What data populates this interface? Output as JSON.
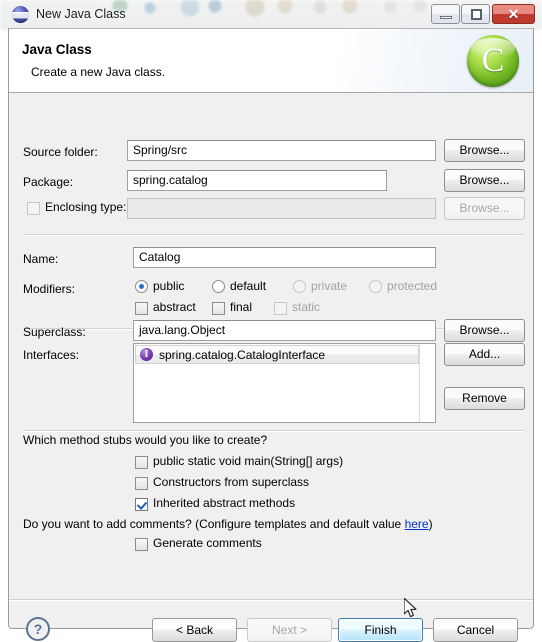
{
  "window": {
    "title": "New Java Class",
    "icon": "java-planet-icon",
    "controls": {
      "minimize": "minimize-button",
      "maximize": "restore-button",
      "close": "✕"
    }
  },
  "header": {
    "title": "Java Class",
    "subtitle": "Create a new Java class.",
    "icon": "java-class-green-c-icon"
  },
  "form": {
    "source_folder": {
      "label": "Source folder:",
      "value": "Spring/src",
      "browse": "Browse..."
    },
    "package": {
      "label": "Package:",
      "value": "spring.catalog",
      "browse": "Browse..."
    },
    "enclosing_type": {
      "label": "Enclosing type:",
      "value": "",
      "checked": false,
      "enabled": false,
      "browse": "Browse..."
    },
    "name": {
      "label": "Name:",
      "value": "Catalog"
    },
    "modifiers": {
      "label": "Modifiers:",
      "radios": [
        {
          "label": "public",
          "selected": true,
          "enabled": true
        },
        {
          "label": "default",
          "selected": false,
          "enabled": true
        },
        {
          "label": "private",
          "selected": false,
          "enabled": false
        },
        {
          "label": "protected",
          "selected": false,
          "enabled": false
        }
      ],
      "checkboxes": [
        {
          "label": "abstract",
          "checked": false,
          "enabled": true
        },
        {
          "label": "final",
          "checked": false,
          "enabled": true
        },
        {
          "label": "static",
          "checked": false,
          "enabled": false
        }
      ]
    },
    "superclass": {
      "label": "Superclass:",
      "value": "java.lang.Object",
      "browse": "Browse..."
    },
    "interfaces": {
      "label": "Interfaces:",
      "items": [
        {
          "name": "spring.catalog.CatalogInterface",
          "icon": "interface-icon"
        }
      ],
      "add": "Add...",
      "remove": "Remove"
    },
    "stubs": {
      "question": "Which method stubs would you like to create?",
      "options": [
        {
          "label": "public static void main(String[] args)",
          "checked": false
        },
        {
          "label": "Constructors from superclass",
          "checked": false
        },
        {
          "label": "Inherited abstract methods",
          "checked": true
        }
      ]
    },
    "comments": {
      "question_prefix": "Do you want to add comments? (Configure templates and default value ",
      "link": "here",
      "question_suffix": ")",
      "option": {
        "label": "Generate comments",
        "checked": false
      }
    }
  },
  "footer": {
    "help": "?",
    "back": "< Back",
    "next": "Next >",
    "finish": "Finish",
    "cancel": "Cancel"
  }
}
